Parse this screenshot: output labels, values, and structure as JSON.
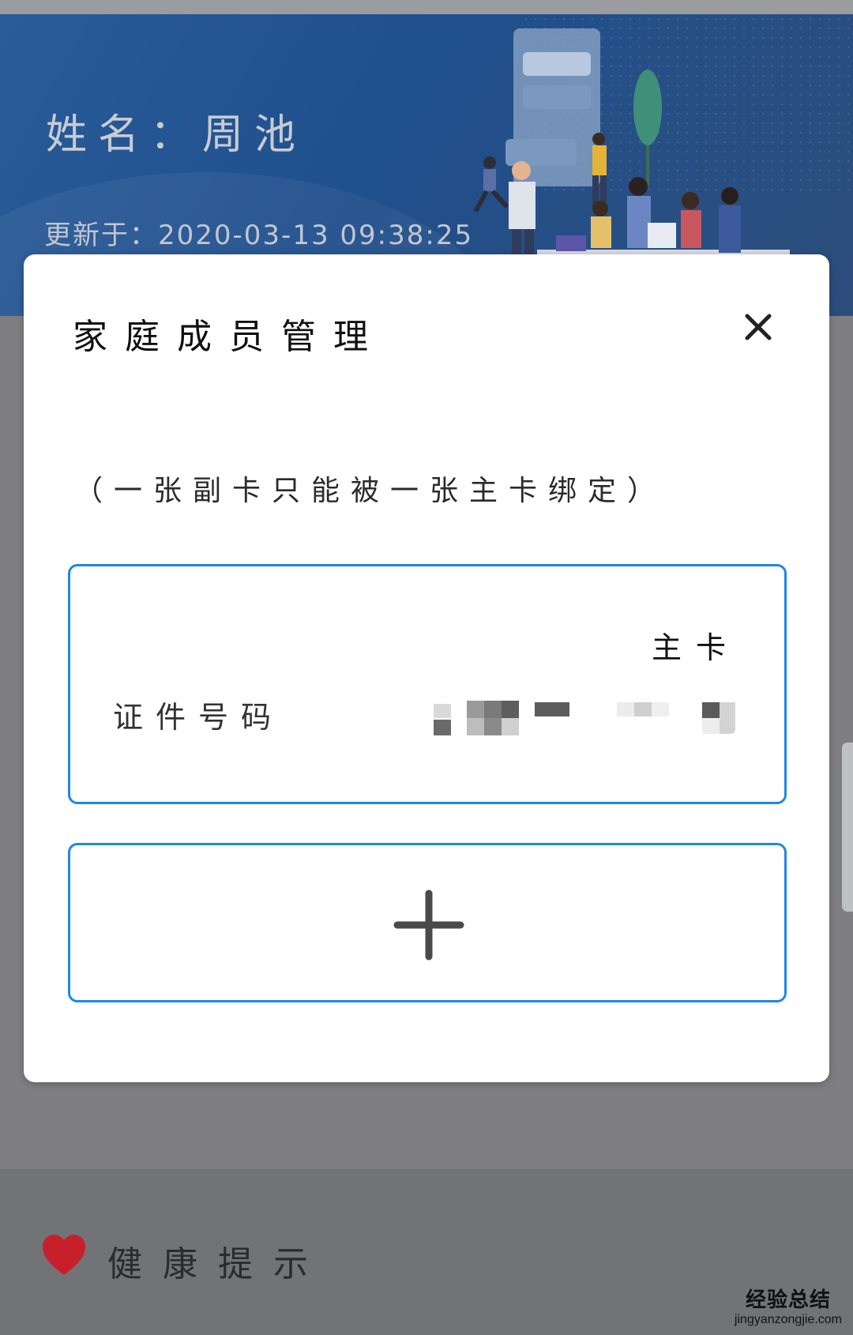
{
  "profile": {
    "name_line": "姓名：周池",
    "updated_line": "更新于：2020-03-13 09:38:25"
  },
  "modal": {
    "title": "家庭成员管理",
    "hint": "（一张副卡只能被一张主卡绑定）",
    "close_icon": "close-icon",
    "primary_card": {
      "tag": "主卡",
      "id_label": "证件号码",
      "id_value": "[obscured]"
    },
    "add_card": {
      "icon": "plus-icon"
    }
  },
  "health": {
    "title": "健康提示",
    "icon": "heart-icon"
  },
  "watermark": {
    "brand": "经验总结",
    "url": "jingyanzongjie.com"
  },
  "colors": {
    "banner": "#1f4f8c",
    "card_border": "#1e88e5",
    "heart": "#c8202a",
    "overlay_bg": "#7f7f82"
  }
}
